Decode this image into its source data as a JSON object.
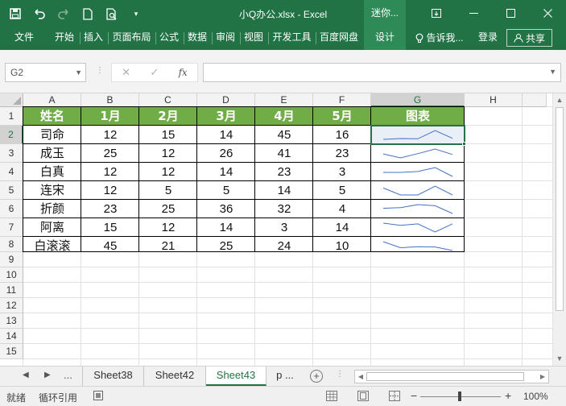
{
  "titlebar": {
    "title": "小Q办公.xlsx - Excel",
    "context_tab": "迷你...",
    "icons": [
      "save-icon",
      "undo-icon",
      "redo-icon",
      "new-file-icon",
      "print-preview-icon",
      "customize-qat-icon"
    ]
  },
  "ribbon": {
    "file": "文件",
    "tabs": [
      "开始",
      "插入",
      "页面布局",
      "公式",
      "数据",
      "审阅",
      "视图",
      "开发工具",
      "百度网盘"
    ],
    "design": "设计",
    "tell_me": "告诉我...",
    "login": "登录",
    "share": "共享"
  },
  "formula_bar": {
    "name_box": "G2",
    "fx": "fx",
    "value": ""
  },
  "columns": [
    "A",
    "B",
    "C",
    "D",
    "E",
    "F",
    "G",
    "H"
  ],
  "rows": [
    "1",
    "2",
    "3",
    "4",
    "5",
    "6",
    "7",
    "8",
    "9",
    "10",
    "11",
    "12",
    "13",
    "14",
    "15"
  ],
  "table": {
    "headers": [
      "姓名",
      "1月",
      "2月",
      "3月",
      "4月",
      "5月",
      "图表"
    ],
    "rows": [
      {
        "name": "司命",
        "values": [
          "12",
          "15",
          "14",
          "45",
          "16"
        ]
      },
      {
        "name": "成玉",
        "values": [
          "25",
          "12",
          "26",
          "41",
          "23"
        ]
      },
      {
        "name": "白真",
        "values": [
          "12",
          "12",
          "14",
          "23",
          "3"
        ]
      },
      {
        "name": "连宋",
        "values": [
          "12",
          "5",
          "5",
          "14",
          "5"
        ]
      },
      {
        "name": "折颜",
        "values": [
          "23",
          "25",
          "36",
          "32",
          "4"
        ]
      },
      {
        "name": "阿离",
        "values": [
          "15",
          "12",
          "14",
          "3",
          "14"
        ]
      },
      {
        "name": "白滚滚",
        "values": [
          "45",
          "21",
          "25",
          "24",
          "10"
        ]
      }
    ],
    "header_color": "#70ad47",
    "sparkline_color": "#4472c4"
  },
  "sheets": {
    "more_left": "...",
    "tabs": [
      "Sheet38",
      "Sheet42",
      "Sheet43",
      "p ..."
    ],
    "active": "Sheet43"
  },
  "statusbar": {
    "ready": "就绪",
    "circular": "循环引用",
    "zoom": "100%"
  },
  "accent": "#217346"
}
